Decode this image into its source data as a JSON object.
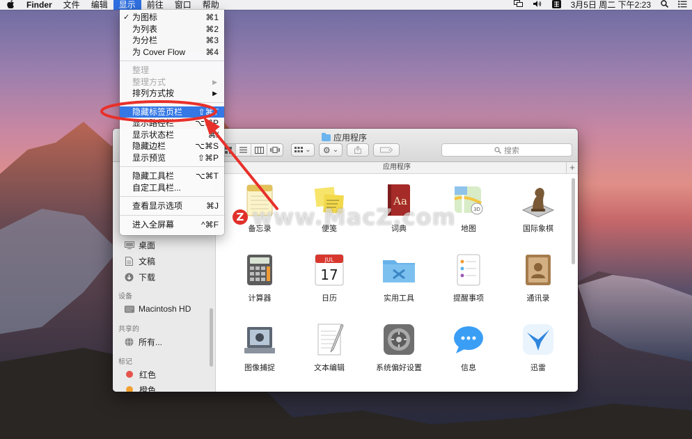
{
  "menubar": {
    "items": [
      "Finder",
      "文件",
      "编辑",
      "显示",
      "前往",
      "窗口",
      "帮助"
    ],
    "active_index": 3,
    "clock": "3月5日 周二 下午2:23"
  },
  "view_menu": {
    "groups": [
      [
        {
          "label": "为图标",
          "shortcut": "⌘1",
          "checked": true
        },
        {
          "label": "为列表",
          "shortcut": "⌘2"
        },
        {
          "label": "为分栏",
          "shortcut": "⌘3"
        },
        {
          "label": "为 Cover Flow",
          "shortcut": "⌘4"
        }
      ],
      [
        {
          "label": "整理",
          "disabled": true
        },
        {
          "label": "整理方式",
          "disabled": true,
          "submenu": true
        },
        {
          "label": "排列方式按",
          "submenu": true
        }
      ],
      [
        {
          "label": "隐藏标签页栏",
          "shortcut": "⇧⌘T",
          "highlighted": true
        },
        {
          "label": "显示路径栏",
          "shortcut": "⌥⌘P"
        },
        {
          "label": "显示状态栏",
          "shortcut": "⌘/"
        },
        {
          "label": "隐藏边栏",
          "shortcut": "⌥⌘S"
        },
        {
          "label": "显示预览",
          "shortcut": "⇧⌘P"
        }
      ],
      [
        {
          "label": "隐藏工具栏",
          "shortcut": "⌥⌘T"
        },
        {
          "label": "自定工具栏..."
        }
      ],
      [
        {
          "label": "查看显示选项",
          "shortcut": "⌘J"
        }
      ],
      [
        {
          "label": "进入全屏幕",
          "shortcut": "^⌘F"
        }
      ]
    ]
  },
  "finder": {
    "title": "应用程序",
    "tab_label": "应用程序",
    "search_placeholder": "搜索",
    "add_tab": "+",
    "sidebar": {
      "favorites": [
        {
          "label": "桌面",
          "icon": "desktop-icon"
        },
        {
          "label": "文稿",
          "icon": "document-icon"
        },
        {
          "label": "下载",
          "icon": "download-icon"
        }
      ],
      "devices_header": "设备",
      "devices": [
        {
          "label": "Macintosh HD",
          "icon": "disk-icon"
        }
      ],
      "shared_header": "共享的",
      "shared": [
        {
          "label": "所有...",
          "icon": "network-icon"
        }
      ],
      "tags_header": "标记",
      "tags": [
        {
          "label": "红色",
          "color": "#e5534b"
        },
        {
          "label": "橙色",
          "color": "#f0a030"
        }
      ]
    },
    "apps": [
      {
        "label": "备忘录",
        "icon": "notes-icon"
      },
      {
        "label": "便笺",
        "icon": "stickies-icon"
      },
      {
        "label": "词典",
        "icon": "dictionary-icon"
      },
      {
        "label": "地图",
        "icon": "maps-icon"
      },
      {
        "label": "国际象棋",
        "icon": "chess-icon"
      },
      {
        "label": "计算器",
        "icon": "calculator-icon"
      },
      {
        "label": "日历",
        "icon": "calendar-icon",
        "calendar_month": "JUL",
        "calendar_day": "17"
      },
      {
        "label": "实用工具",
        "icon": "utilities-folder-icon"
      },
      {
        "label": "提醒事项",
        "icon": "reminders-icon"
      },
      {
        "label": "通讯录",
        "icon": "contacts-icon"
      },
      {
        "label": "图像捕捉",
        "icon": "image-capture-icon"
      },
      {
        "label": "文本编辑",
        "icon": "textedit-icon"
      },
      {
        "label": "系统偏好设置",
        "icon": "system-preferences-icon"
      },
      {
        "label": "信息",
        "icon": "messages-icon"
      },
      {
        "label": "迅雷",
        "icon": "thunder-icon"
      }
    ]
  },
  "watermark": {
    "logo": "Z",
    "text": "www.MacZ.com"
  },
  "colors": {
    "menu_highlight": "#3578e5",
    "annotation_red": "#e8302a"
  }
}
